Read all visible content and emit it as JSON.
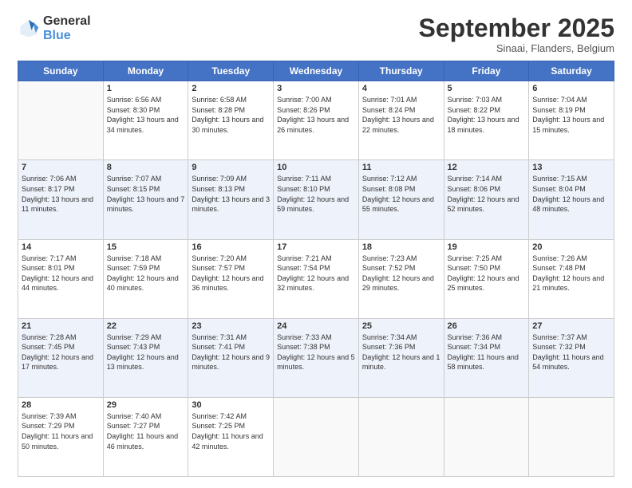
{
  "logo": {
    "general": "General",
    "blue": "Blue"
  },
  "header": {
    "month_title": "September 2025",
    "location": "Sinaai, Flanders, Belgium"
  },
  "days_of_week": [
    "Sunday",
    "Monday",
    "Tuesday",
    "Wednesday",
    "Thursday",
    "Friday",
    "Saturday"
  ],
  "weeks": [
    {
      "cells": [
        {
          "day": "",
          "empty": true
        },
        {
          "day": "1",
          "sunrise": "6:56 AM",
          "sunset": "8:30 PM",
          "daylight": "13 hours and 34 minutes."
        },
        {
          "day": "2",
          "sunrise": "6:58 AM",
          "sunset": "8:28 PM",
          "daylight": "13 hours and 30 minutes."
        },
        {
          "day": "3",
          "sunrise": "7:00 AM",
          "sunset": "8:26 PM",
          "daylight": "13 hours and 26 minutes."
        },
        {
          "day": "4",
          "sunrise": "7:01 AM",
          "sunset": "8:24 PM",
          "daylight": "13 hours and 22 minutes."
        },
        {
          "day": "5",
          "sunrise": "7:03 AM",
          "sunset": "8:22 PM",
          "daylight": "13 hours and 18 minutes."
        },
        {
          "day": "6",
          "sunrise": "7:04 AM",
          "sunset": "8:19 PM",
          "daylight": "13 hours and 15 minutes."
        }
      ]
    },
    {
      "cells": [
        {
          "day": "7",
          "sunrise": "7:06 AM",
          "sunset": "8:17 PM",
          "daylight": "13 hours and 11 minutes."
        },
        {
          "day": "8",
          "sunrise": "7:07 AM",
          "sunset": "8:15 PM",
          "daylight": "13 hours and 7 minutes."
        },
        {
          "day": "9",
          "sunrise": "7:09 AM",
          "sunset": "8:13 PM",
          "daylight": "13 hours and 3 minutes."
        },
        {
          "day": "10",
          "sunrise": "7:11 AM",
          "sunset": "8:10 PM",
          "daylight": "12 hours and 59 minutes."
        },
        {
          "day": "11",
          "sunrise": "7:12 AM",
          "sunset": "8:08 PM",
          "daylight": "12 hours and 55 minutes."
        },
        {
          "day": "12",
          "sunrise": "7:14 AM",
          "sunset": "8:06 PM",
          "daylight": "12 hours and 52 minutes."
        },
        {
          "day": "13",
          "sunrise": "7:15 AM",
          "sunset": "8:04 PM",
          "daylight": "12 hours and 48 minutes."
        }
      ]
    },
    {
      "cells": [
        {
          "day": "14",
          "sunrise": "7:17 AM",
          "sunset": "8:01 PM",
          "daylight": "12 hours and 44 minutes."
        },
        {
          "day": "15",
          "sunrise": "7:18 AM",
          "sunset": "7:59 PM",
          "daylight": "12 hours and 40 minutes."
        },
        {
          "day": "16",
          "sunrise": "7:20 AM",
          "sunset": "7:57 PM",
          "daylight": "12 hours and 36 minutes."
        },
        {
          "day": "17",
          "sunrise": "7:21 AM",
          "sunset": "7:54 PM",
          "daylight": "12 hours and 32 minutes."
        },
        {
          "day": "18",
          "sunrise": "7:23 AM",
          "sunset": "7:52 PM",
          "daylight": "12 hours and 29 minutes."
        },
        {
          "day": "19",
          "sunrise": "7:25 AM",
          "sunset": "7:50 PM",
          "daylight": "12 hours and 25 minutes."
        },
        {
          "day": "20",
          "sunrise": "7:26 AM",
          "sunset": "7:48 PM",
          "daylight": "12 hours and 21 minutes."
        }
      ]
    },
    {
      "cells": [
        {
          "day": "21",
          "sunrise": "7:28 AM",
          "sunset": "7:45 PM",
          "daylight": "12 hours and 17 minutes."
        },
        {
          "day": "22",
          "sunrise": "7:29 AM",
          "sunset": "7:43 PM",
          "daylight": "12 hours and 13 minutes."
        },
        {
          "day": "23",
          "sunrise": "7:31 AM",
          "sunset": "7:41 PM",
          "daylight": "12 hours and 9 minutes."
        },
        {
          "day": "24",
          "sunrise": "7:33 AM",
          "sunset": "7:38 PM",
          "daylight": "12 hours and 5 minutes."
        },
        {
          "day": "25",
          "sunrise": "7:34 AM",
          "sunset": "7:36 PM",
          "daylight": "12 hours and 1 minute."
        },
        {
          "day": "26",
          "sunrise": "7:36 AM",
          "sunset": "7:34 PM",
          "daylight": "11 hours and 58 minutes."
        },
        {
          "day": "27",
          "sunrise": "7:37 AM",
          "sunset": "7:32 PM",
          "daylight": "11 hours and 54 minutes."
        }
      ]
    },
    {
      "cells": [
        {
          "day": "28",
          "sunrise": "7:39 AM",
          "sunset": "7:29 PM",
          "daylight": "11 hours and 50 minutes."
        },
        {
          "day": "29",
          "sunrise": "7:40 AM",
          "sunset": "7:27 PM",
          "daylight": "11 hours and 46 minutes."
        },
        {
          "day": "30",
          "sunrise": "7:42 AM",
          "sunset": "7:25 PM",
          "daylight": "11 hours and 42 minutes."
        },
        {
          "day": "",
          "empty": true
        },
        {
          "day": "",
          "empty": true
        },
        {
          "day": "",
          "empty": true
        },
        {
          "day": "",
          "empty": true
        }
      ]
    }
  ]
}
